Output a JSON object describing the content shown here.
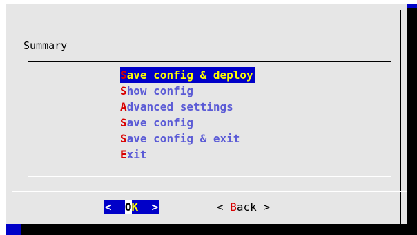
{
  "colors": {
    "screen": "#0000c8",
    "dialog": "#e6e6e6",
    "menu_text": "#5b5bd6",
    "hotkey": "#d80000",
    "selected_bg": "#0000c8",
    "selected_text": "#ffff00"
  },
  "dialog": {
    "label": "Summary"
  },
  "menu": {
    "selected_index": 0,
    "items": [
      {
        "hot": "S",
        "rest": "ave config & deploy"
      },
      {
        "hot": "S",
        "rest": "how config"
      },
      {
        "hot": "A",
        "rest": "dvanced settings"
      },
      {
        "hot": "S",
        "rest": "ave config"
      },
      {
        "hot": "S",
        "rest": "ave config & exit"
      },
      {
        "hot": "E",
        "rest": "xit"
      }
    ]
  },
  "buttons": {
    "ok": {
      "left": "<  ",
      "hot": "O",
      "rest": "K",
      "right": "  >"
    },
    "back": {
      "left": "< ",
      "hot": "B",
      "rest": "ack",
      "right": " >"
    }
  }
}
